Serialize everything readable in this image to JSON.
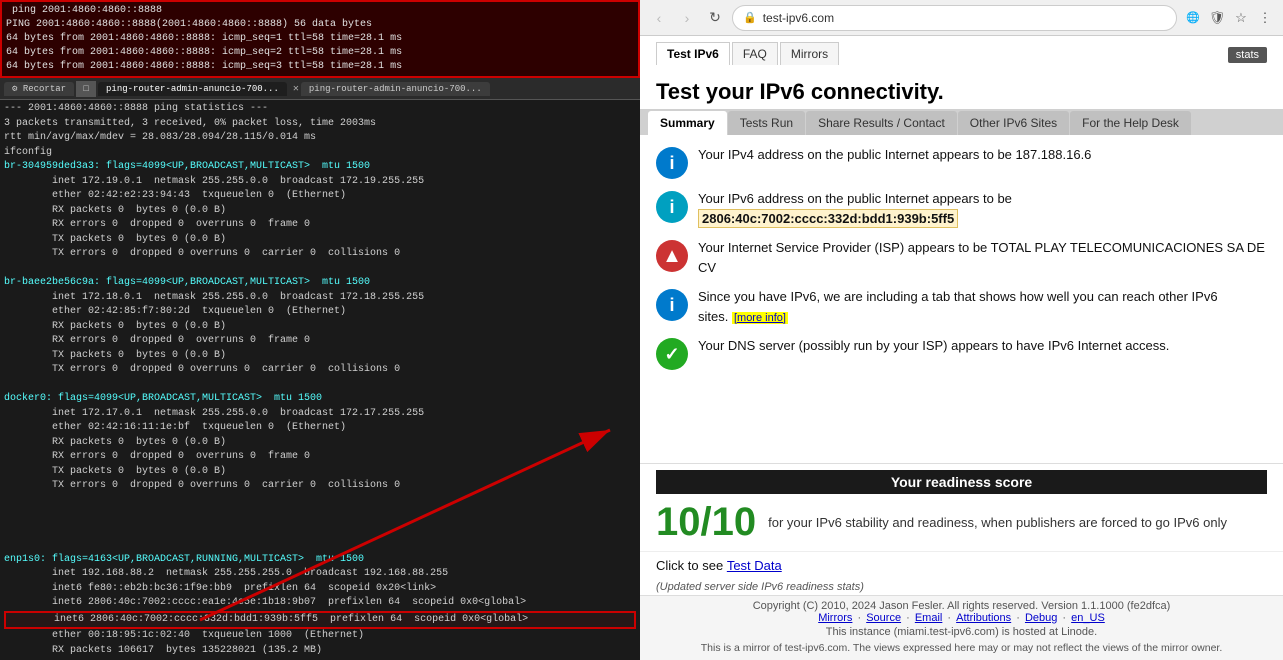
{
  "terminal": {
    "top_block": [
      "ping 2001:4860:4860::8888",
      "PING 2001:4860:4860::8888(2001:4860:4860::8888) 56 data bytes",
      "64 bytes from 2001:4860:4860::8888: icmp_seq=1 ttl=58 time=28.1 ms",
      "64 bytes from 2001:4860:4860::8888: icmp_seq=2 ttl=58 time=28.1 ms",
      "64 bytes from 2001:4860:4860::8888: icmp_seq=3 ttl=58 time=28.1 ms"
    ],
    "tabs": [
      {
        "label": "ping-router-admin-anuncio-700...",
        "active": false
      },
      {
        "label": "ping-router-admin-anuncio-700...",
        "active": true
      }
    ],
    "lines": [
      "--- 2001:4860:4860::8888 ping statistics ---",
      "3 packets transmitted, 3 received, 0% packet loss, time 2003ms",
      "rtt min/avg/max/mdev = 28.083/28.094/28.115/0.014 ms",
      "ifconfig",
      "br-304959ded3a3: flags=4099<UP,BROADCAST,MULTICAST>  mtu 1500",
      "        inet 172.19.0.1  netmask 255.255.0.0  broadcast 172.19.255.255",
      "        ether 02:42:e2:23:94:43  txqueuelen 0  (Ethernet)",
      "        RX packets 0  bytes 0 (0.0 B)",
      "        RX errors 0  dropped 0  overruns 0  frame 0",
      "        TX packets 0  bytes 0 (0.0 B)",
      "        TX errors 0  dropped 0 overruns 0  carrier 0  collisions 0",
      "",
      "br-baee2be56c9a: flags=4099<UP,BROADCAST,MULTICAST>  mtu 1500",
      "        inet 172.18.0.1  netmask 255.255.0.0  broadcast 172.18.255.255",
      "        ether 02:42:85:f7:80:2d  txqueuelen 0  (Ethernet)",
      "        RX packets 0  bytes 0 (0.0 B)",
      "        RX errors 0  dropped 0  overruns 0  frame 0",
      "        TX packets 0  bytes 0 (0.0 B)",
      "        TX errors 0  dropped 0 overruns 0  carrier 0  collisions 0",
      "",
      "docker0: flags=4099<UP,BROADCAST,MULTICAST>  mtu 1500",
      "        inet 172.17.0.1  netmask 255.255.0.0  broadcast 172.17.255.255",
      "        ether 02:42:16:11:1e:bf  txqueuelen 0  (Ethernet)",
      "        RX packets 0  bytes 0 (0.0 B)",
      "        RX errors 0  dropped 0  overruns 0  frame 0",
      "        TX packets 0  bytes 0 (0.0 B)",
      "        TX errors 0  dropped 0 overruns 0  carrier 0  collisions 0"
    ],
    "bottom_lines": [
      "enp1s0: flags=4163<UP,BROADCAST,RUNNING,MULTICAST>  mtu 1500",
      "        inet 192.168.88.2  netmask 255.255.255.0  broadcast 192.168.88.255",
      "        inet6 fe80::eb2b:bc36:1f9e:bb9  prefixlen 64  scopeid 0x20<link>",
      "        inet6 2806:40c:7002:cccc:ea1e:4e5e:1b18:9b07  prefixlen 64  scopeid 0x0<global>",
      "        inet6 2806:40c:7002:cccc:332d:bdd1:939b:5ff5  prefixlen 64  scopeid 0x0<global>",
      "        ether 00:18:95:1c:02:40  txqueuelen 1000  (Ethernet)",
      "        RX packets 106617  bytes 135228021 (135.2 MB)"
    ],
    "highlighted_line": "        inet6 2806:40c:7002:cccc:332d:bdd1:939b:5ff5  prefixlen 64  scopeid 0x0<global>"
  },
  "browser": {
    "url": "test-ipv6.com",
    "nav_buttons": [
      "◀",
      "▶",
      "↻"
    ],
    "site_tabs": [
      {
        "label": "Test IPv6",
        "active": true
      },
      {
        "label": "FAQ",
        "active": false
      },
      {
        "label": "Mirrors",
        "active": false
      }
    ],
    "stats_button": "stats",
    "page_title": "Test your IPv6 connectivity.",
    "content_tabs": [
      {
        "label": "Summary",
        "active": true
      },
      {
        "label": "Tests Run",
        "active": false
      },
      {
        "label": "Share Results / Contact",
        "active": false
      },
      {
        "label": "Other IPv6 Sites",
        "active": false
      },
      {
        "label": "For the Help Desk",
        "active": false
      }
    ],
    "info_items": [
      {
        "icon": "i",
        "icon_type": "blue",
        "text": "Your IPv4 address on the public Internet appears to be 187.188.16.6"
      },
      {
        "icon": "i",
        "icon_type": "teal",
        "text": "Your IPv6 address on the public Internet appears to be",
        "highlight": "2806:40c:7002:cccc:332d:bdd1:939b:5ff5"
      },
      {
        "icon": "▲",
        "icon_type": "arrow",
        "text": "Your Internet Service Provider (ISP) appears to be TOTAL PLAY TELECOMUNICACIONES SA DE CV"
      },
      {
        "icon": "i",
        "icon_type": "blue",
        "text": "Since you have IPv6, we are including a tab that shows how well you can reach other IPv6 sites.",
        "more_info": "[more info]"
      },
      {
        "icon": "✓",
        "icon_type": "green",
        "text": "Your DNS server (possibly run by your ISP) appears to have IPv6 Internet access."
      }
    ],
    "readiness_header": "Your readiness score",
    "score": "10/10",
    "score_desc": "for your IPv6 stability and readiness, when publishers are forced to go IPv6 only",
    "test_data_prefix": "Click to see",
    "test_data_link": "Test Data",
    "updated_text": "(Updated server side IPv6 readiness stats)",
    "hosted_line": "This instance (miami.test-ipv6.com) is hosted at Linode.",
    "copyright": "Copyright (C) 2010, 2024 Jason Fesler. All rights reserved. Version 1.1.1000 (fe2dfca)",
    "footer_links": [
      "Mirrors",
      "Source",
      "Email",
      "Attributions",
      "Debug"
    ],
    "footer_locale": "en_US",
    "mirror_text": "This is a mirror of test-ipv6.com. The views expressed here may or may not reflect the views of the mirror owner."
  }
}
